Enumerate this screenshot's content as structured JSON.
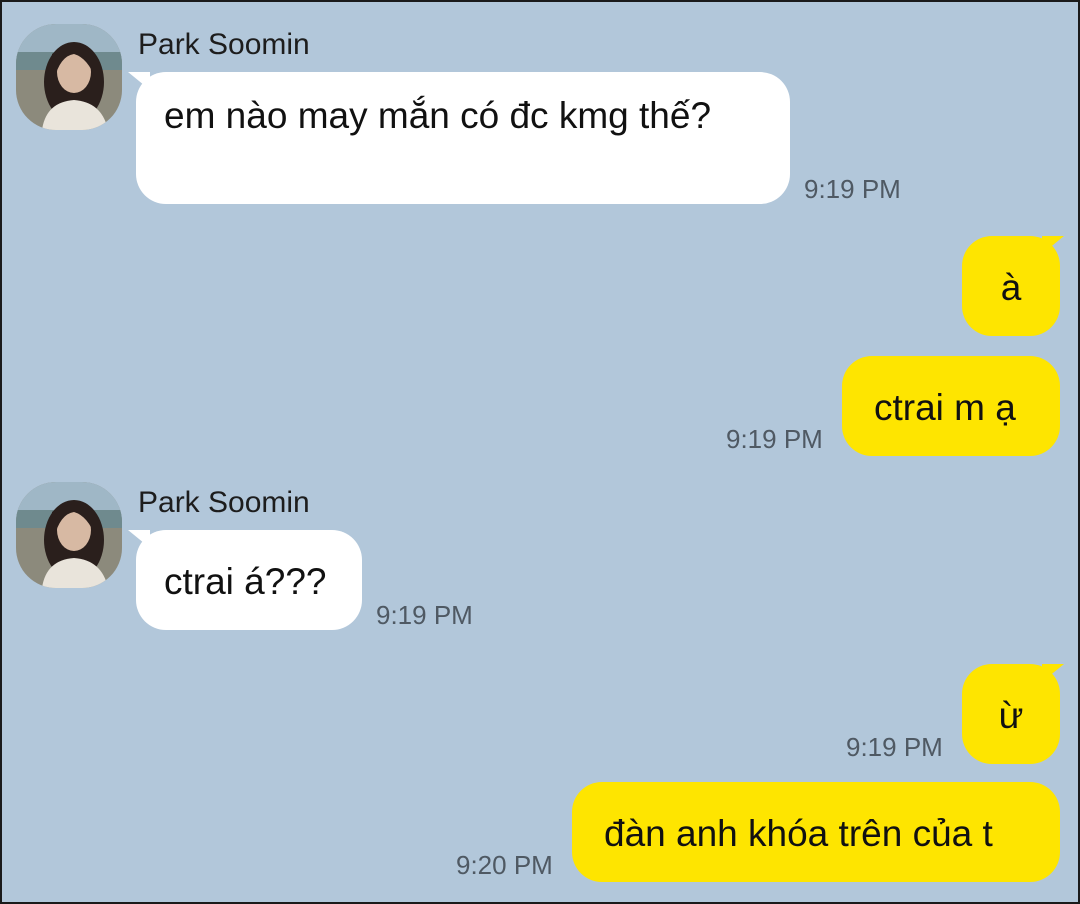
{
  "chat": {
    "colors": {
      "background": "#b2c7da",
      "incoming_bubble": "#ffffff",
      "outgoing_bubble": "#fee500",
      "timestamp": "#4f5963"
    },
    "messages": [
      {
        "direction": "in",
        "sender": "Park Soomin",
        "avatar": "profile-photo",
        "text": "em nào may mắn có đc kmg thế?",
        "time": "9:19 PM"
      },
      {
        "direction": "out",
        "text": "à",
        "time": ""
      },
      {
        "direction": "out",
        "text": "ctrai m ạ",
        "time": "9:19 PM"
      },
      {
        "direction": "in",
        "sender": "Park Soomin",
        "avatar": "profile-photo",
        "text": "ctrai á???",
        "time": "9:19 PM"
      },
      {
        "direction": "out",
        "text": "ừ",
        "time": "9:19 PM"
      },
      {
        "direction": "out",
        "text": "đàn anh khóa trên của t",
        "time": "9:20 PM"
      }
    ]
  }
}
